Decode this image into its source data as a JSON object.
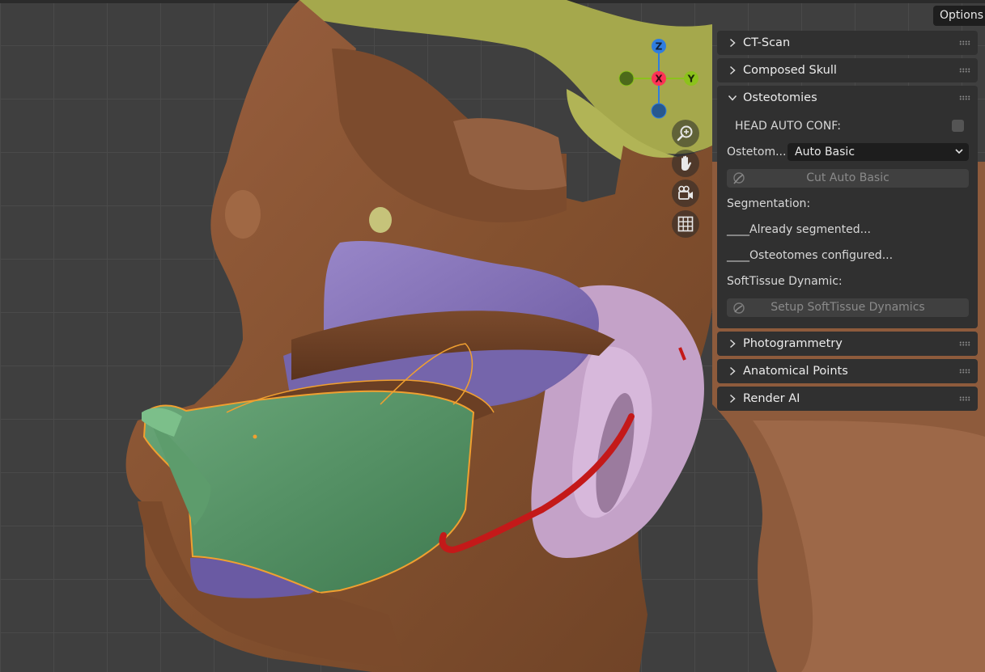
{
  "viewport": {
    "options_label": "Options",
    "gizmo": {
      "z_label": "Z",
      "x_label": "X",
      "y_label": "Y"
    },
    "nav_icons": [
      "zoom-icon",
      "pan-hand-icon",
      "camera-icon",
      "grid-icon"
    ]
  },
  "panels": {
    "ct_scan": {
      "title": "CT-Scan",
      "expanded": false
    },
    "composed_skull": {
      "title": "Composed Skull",
      "expanded": false
    },
    "osteotomies": {
      "title": "Osteotomies",
      "expanded": true,
      "head_auto_conf_label": "HEAD AUTO CONF:",
      "head_auto_conf_checked": false,
      "osteotomy_label": "Ostetom...",
      "osteotomy_value": "Auto Basic",
      "cut_button": "Cut Auto Basic",
      "segmentation_label": "Segmentation:",
      "already_segmented": "____Already segmented...",
      "osteotomes_configured": "____Osteotomes configured...",
      "softtissue_label": "SoftTissue Dynamic:",
      "setup_softtissue_button": "Setup SoftTissue Dynamics"
    },
    "photogrammetry": {
      "title": "Photogrammetry",
      "expanded": false
    },
    "anatomical_points": {
      "title": "Anatomical Points",
      "expanded": false
    },
    "render_ai": {
      "title": "Render AI",
      "expanded": false
    }
  },
  "colors": {
    "bone": "#8a5637",
    "skull_yellow": "#a9ad4f",
    "mandible_green": "#4f8a5f",
    "purple_tissue": "#7c6bb0",
    "pink_tissue": "#c8a2cc",
    "nerve_red": "#c81a1a",
    "selection_outline": "#f0a030",
    "axis_x": "#ff3355",
    "axis_y": "#8cc21c",
    "axis_z": "#2f7de0"
  }
}
